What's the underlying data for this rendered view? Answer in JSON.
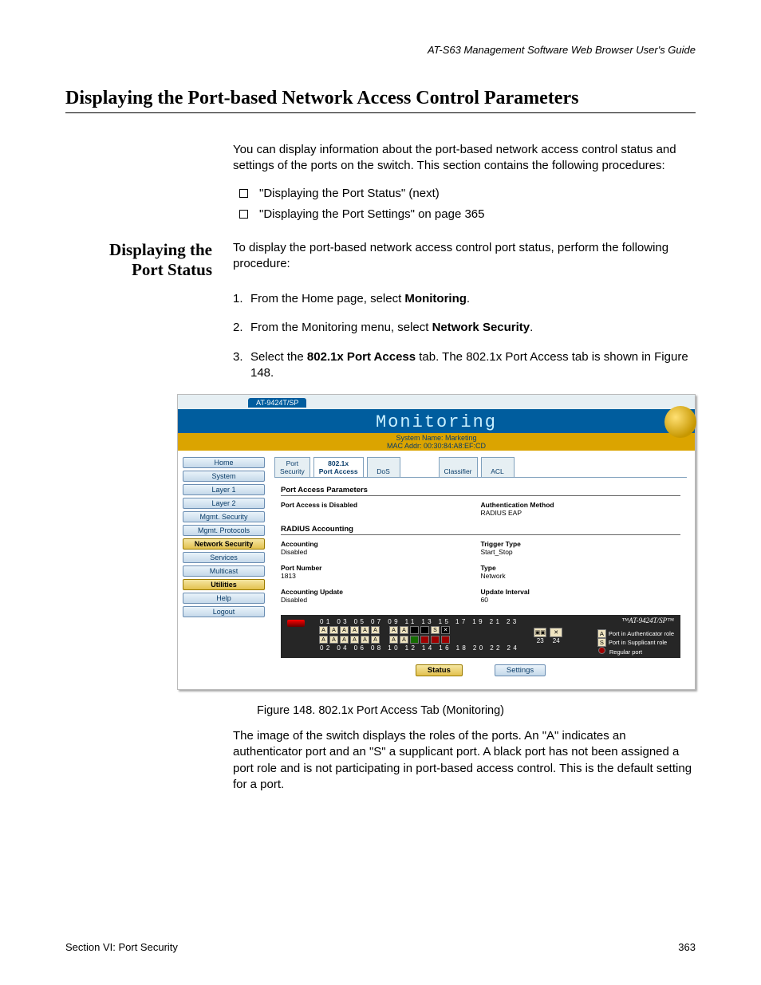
{
  "header": {
    "guide": "AT-S63 Management Software Web Browser User's Guide"
  },
  "h1": "Displaying the Port-based Network Access Control Parameters",
  "intro": "You can display information about the port-based network access control status and settings of the ports on the switch. This section contains the following procedures:",
  "bullets": [
    "\"Displaying the Port Status\" (next)",
    "\"Displaying the Port Settings\" on page 365"
  ],
  "sidehead": {
    "l1": "Displaying the",
    "l2": "Port Status"
  },
  "sidebody": "To display the port-based network access control port status, perform the following procedure:",
  "steps": [
    {
      "pre": "From the Home page, select ",
      "bold": "Monitoring",
      "post": "."
    },
    {
      "pre": "From the Monitoring menu, select ",
      "bold": "Network Security",
      "post": "."
    },
    {
      "pre": "Select the ",
      "bold": "802.1x Port Access",
      "post": " tab. The 802.1x Port Access tab is shown in Figure 148."
    }
  ],
  "screenshot": {
    "filetab": "AT-9424T/SP",
    "banner": "Monitoring",
    "sysline": {
      "a": "System Name: Marketing",
      "b": "MAC Addr: 00:30:84:A8:EF:CD"
    },
    "nav": [
      "Home",
      "System",
      "Layer 1",
      "Layer 2",
      "Mgmt. Security",
      "Mgmt. Protocols",
      "Network Security",
      "Services",
      "Multicast",
      "Utilities",
      "Help",
      "Logout"
    ],
    "nav_active": "Network Security",
    "subtabs": {
      "g1": [
        {
          "l1": "Port",
          "l2": "Security"
        },
        {
          "l1": "802.1x",
          "l2": "Port Access"
        },
        {
          "l1": "",
          "l2": "DoS"
        }
      ],
      "g2": [
        {
          "l1": "",
          "l2": "Classifier"
        },
        {
          "l1": "",
          "l2": "ACL"
        }
      ],
      "active": "802.1x"
    },
    "sect_pap": "Port Access Parameters",
    "pap": {
      "left_text": "Port Access is Disabled",
      "right_lab": "Authentication Method",
      "right_val": "RADIUS EAP"
    },
    "sect_ra": "RADIUS Accounting",
    "ra": [
      {
        "l": "Accounting",
        "lv": "Disabled",
        "r": "Trigger Type",
        "rv": "Start_Stop"
      },
      {
        "l": "Port Number",
        "lv": "1813",
        "r": "Type",
        "rv": "Network"
      },
      {
        "l": "Accounting Update",
        "lv": "Disabled",
        "r": "Update Interval",
        "rv": "60"
      }
    ],
    "switch": {
      "model": "AT-9424T/SP",
      "top_nums": "01 03 05 07 09 11   13 15 17 19 21 23",
      "bot_nums": "02 04 06 08 10 12   14 16 18 20 22 24",
      "row1a": [
        "A",
        "A",
        "A",
        "A",
        "A",
        "A"
      ],
      "row1b": [
        "A",
        "A",
        "",
        "",
        "S",
        ""
      ],
      "row2a": [
        "A",
        "A",
        "A",
        "A",
        "A",
        "A"
      ],
      "row2b": [
        "A",
        "A",
        "",
        "",
        "",
        ""
      ],
      "sfp": [
        "23",
        "24"
      ],
      "legend": {
        "a": "Port in Authenticator role",
        "s": "Port in Supplicant role",
        "r": "Regular port"
      }
    },
    "buttons": {
      "status": "Status",
      "settings": "Settings"
    }
  },
  "caption": "Figure 148. 802.1x Port Access Tab (Monitoring)",
  "after": "The image of the switch displays the roles of the ports. An \"A\" indicates an authenticator port and an \"S\" a supplicant port. A black port has not been assigned a port role and is not participating in port-based access control. This is the default setting for a port.",
  "footer": {
    "left": "Section VI: Port Security",
    "right": "363"
  }
}
